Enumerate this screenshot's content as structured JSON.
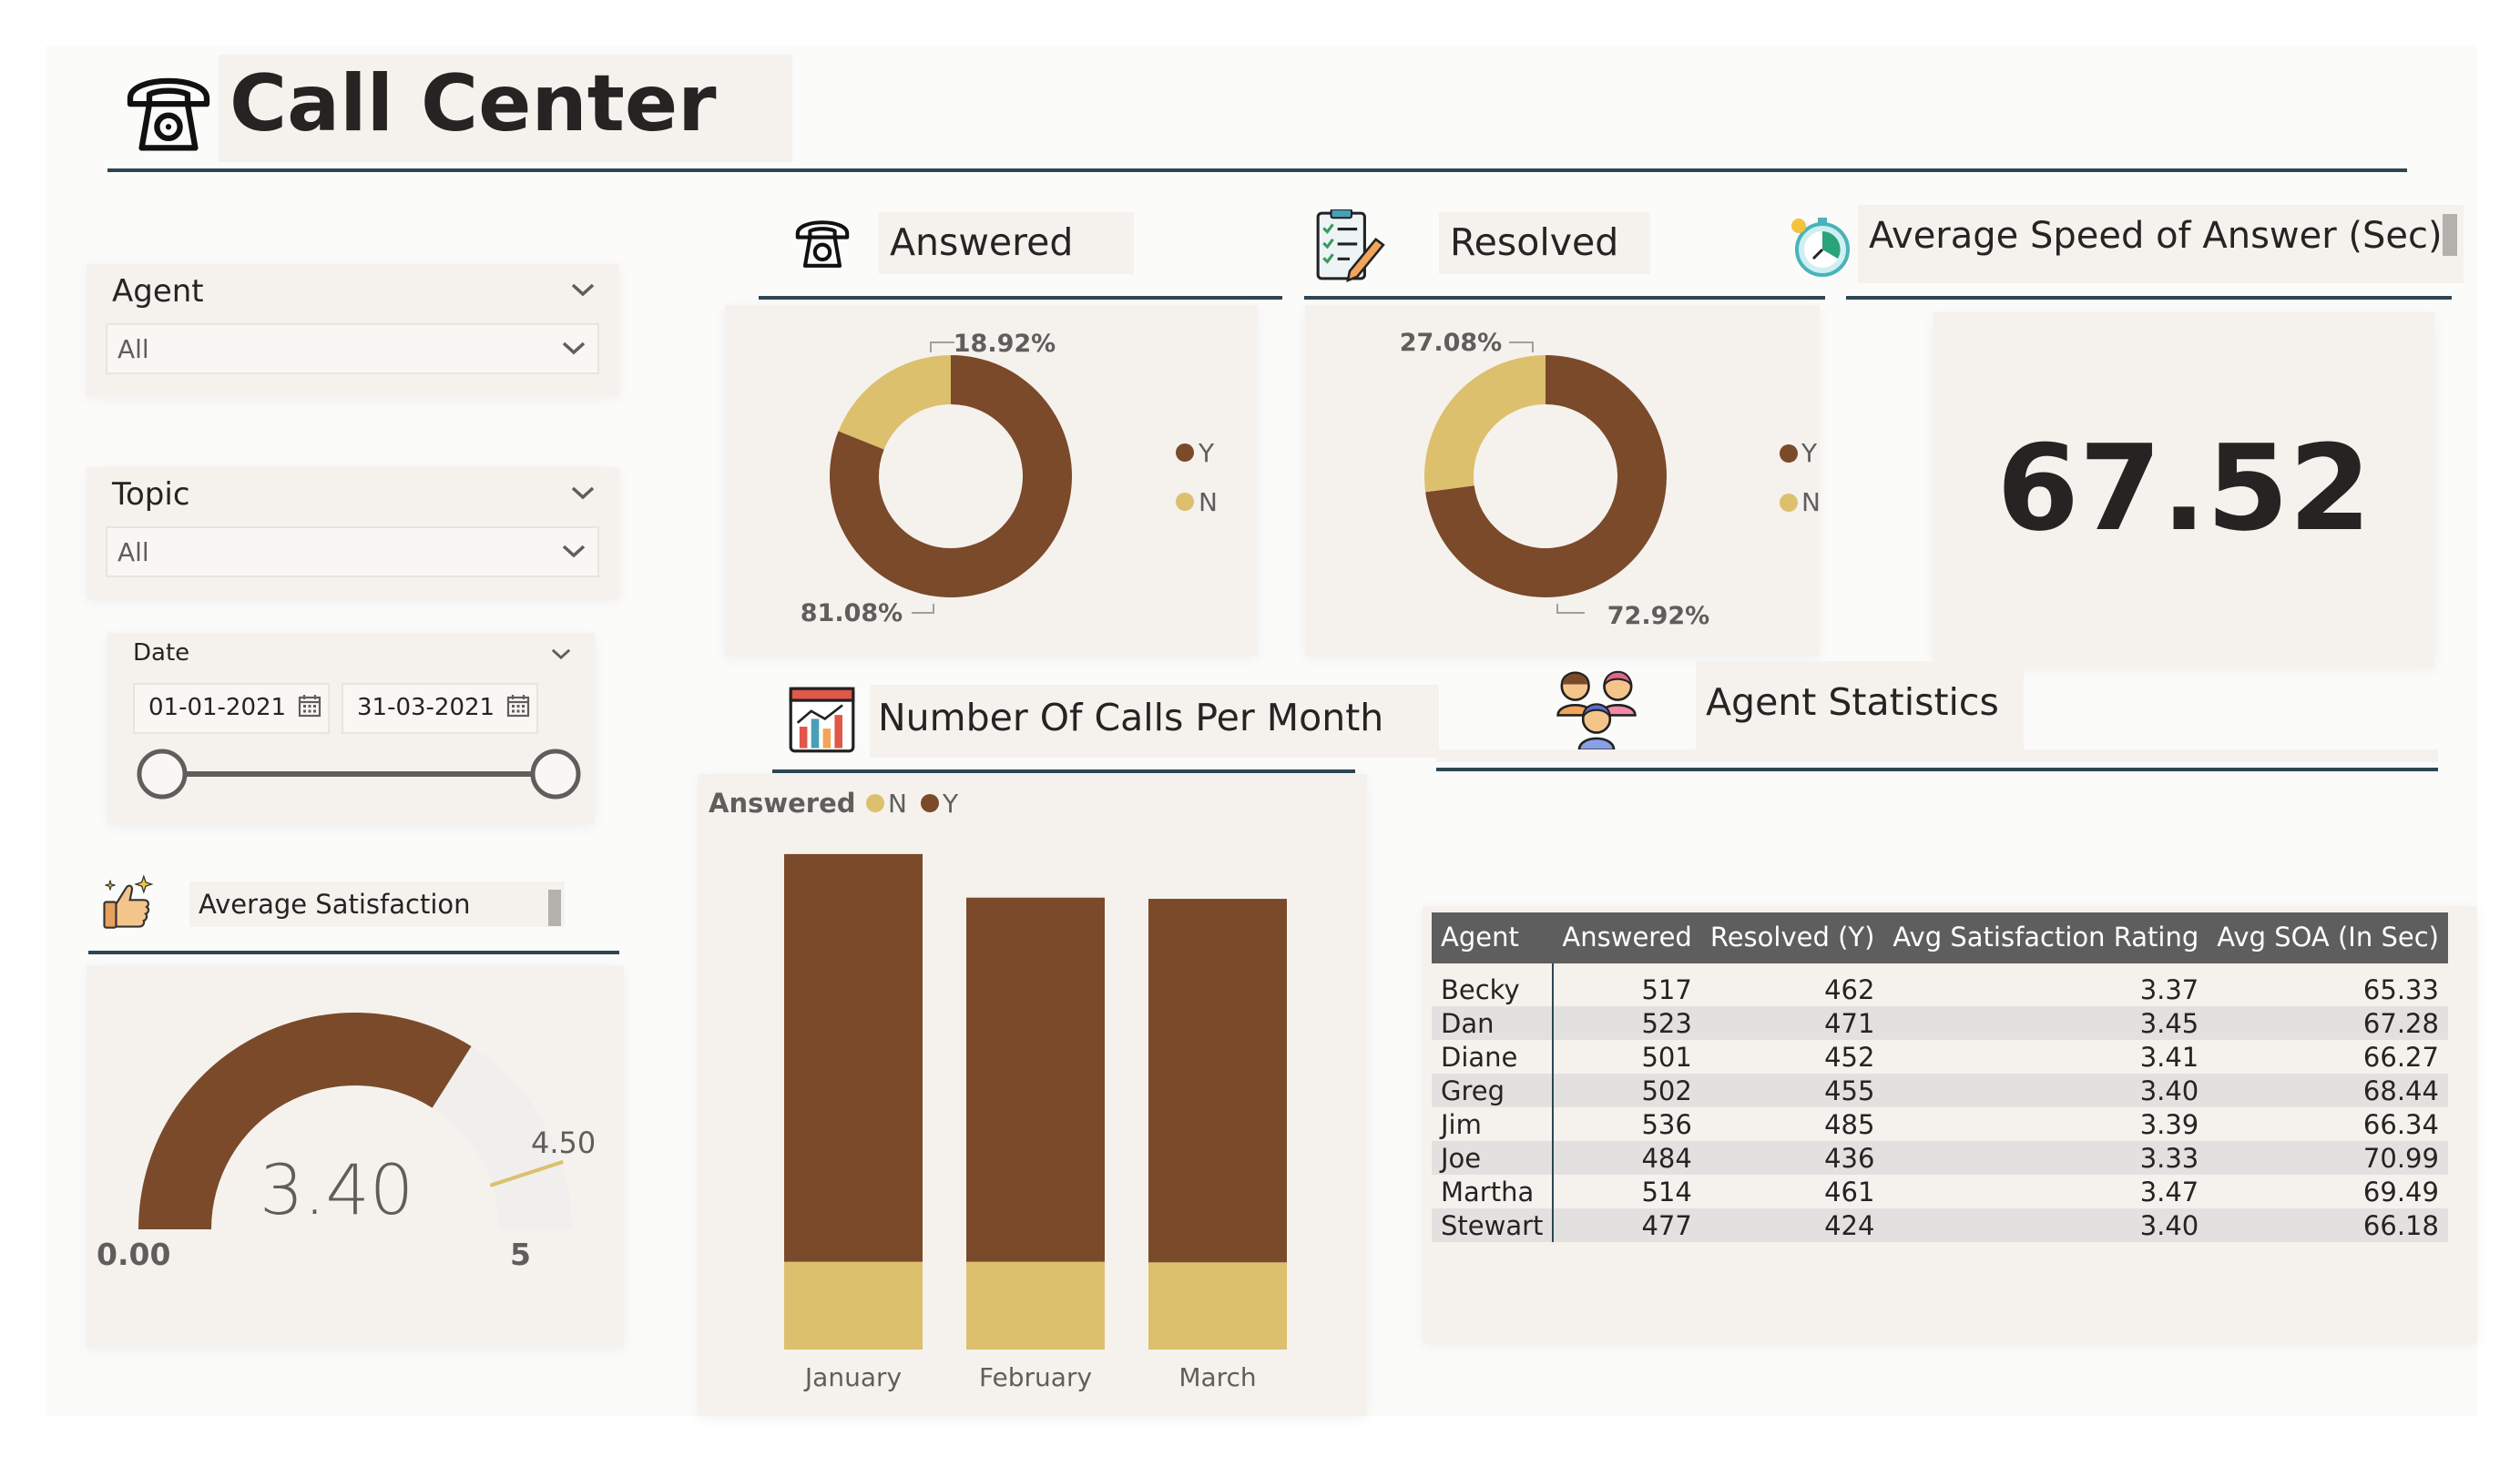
{
  "title": "Call Center",
  "slicers": {
    "agent": {
      "title": "Agent",
      "value": "All"
    },
    "topic": {
      "title": "Topic",
      "value": "All"
    },
    "date": {
      "title": "Date",
      "start": "01-01-2021",
      "end": "31-03-2021"
    }
  },
  "satisfaction": {
    "title": "Average Satisfaction Rating",
    "value": "3.40",
    "min": "0.00",
    "max": "5",
    "target": "4.50",
    "value_num": 3.4,
    "max_num": 5,
    "target_num": 4.5
  },
  "answered": {
    "title": "Answered",
    "legend": [
      "Y",
      "N"
    ],
    "slices": [
      {
        "label": "Y",
        "value": 81.08,
        "text": "81.08%",
        "color": "#7a4a2a"
      },
      {
        "label": "N",
        "value": 18.92,
        "text": "18.92%",
        "color": "#dcc06e"
      }
    ]
  },
  "resolved": {
    "title": "Resolved",
    "legend": [
      "Y",
      "N"
    ],
    "slices": [
      {
        "label": "Y",
        "value": 72.92,
        "text": "72.92%",
        "color": "#7a4a2a"
      },
      {
        "label": "N",
        "value": 27.08,
        "text": "27.08%",
        "color": "#dcc06e"
      }
    ]
  },
  "asa": {
    "title": "Average Speed of Answer (Sec)",
    "value": "67.52"
  },
  "calls": {
    "title": "Number Of Calls Per Month",
    "legend_title": "Answered",
    "legend": [
      "N",
      "Y"
    ]
  },
  "chart_data": {
    "type": "bar",
    "stacked": true,
    "categories": [
      "January",
      "February",
      "March"
    ],
    "series": [
      {
        "name": "N",
        "values": [
          147,
          147,
          146
        ],
        "color": "#dcc06e"
      },
      {
        "name": "Y",
        "values": [
          683,
          610,
          609
        ],
        "color": "#7a4a2a"
      }
    ],
    "ylim": [
      0,
      900
    ],
    "grid": false,
    "legend_position": "top-left"
  },
  "agent_stats": {
    "title": "Agent Statistics",
    "columns": [
      "Agent",
      "Answered",
      "Resolved (Y)",
      "Avg Satisfaction Rating",
      "Avg SOA (In Sec)"
    ],
    "rows": [
      [
        "Becky",
        "517",
        "462",
        "3.37",
        "65.33"
      ],
      [
        "Dan",
        "523",
        "471",
        "3.45",
        "67.28"
      ],
      [
        "Diane",
        "501",
        "452",
        "3.41",
        "66.27"
      ],
      [
        "Greg",
        "502",
        "455",
        "3.40",
        "68.44"
      ],
      [
        "Jim",
        "536",
        "485",
        "3.39",
        "66.34"
      ],
      [
        "Joe",
        "484",
        "436",
        "3.33",
        "70.99"
      ],
      [
        "Martha",
        "514",
        "461",
        "3.47",
        "69.49"
      ],
      [
        "Stewart",
        "477",
        "424",
        "3.40",
        "66.18"
      ]
    ]
  },
  "icons": {
    "header": "telephone-icon",
    "answered": "telephone-icon",
    "resolved": "checklist-icon",
    "asa": "stopwatch-icon",
    "calls": "bar-chart-icon",
    "agents": "agents-group-icon",
    "satisfaction": "thumbs-up-sparkle-icon"
  }
}
